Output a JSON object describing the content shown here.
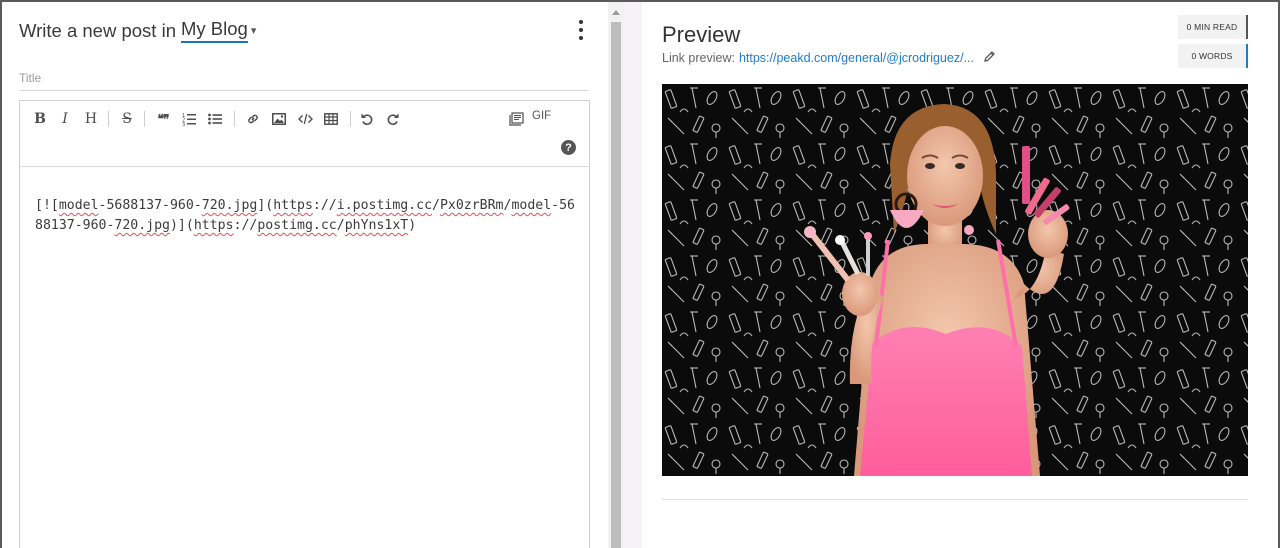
{
  "editor": {
    "header_prefix": "Write a new post in",
    "blog_name": "My Blog",
    "title_placeholder": "Title",
    "gif_label": "GIF",
    "help_label": "?",
    "toolbar": {
      "bold": "B",
      "italic": "I",
      "heading": "H",
      "strike": "S",
      "quote": "❝❞"
    },
    "markdown": {
      "p1": "[![",
      "p2": "model",
      "p3": "-5688137-960-",
      "p4": "720.jpg",
      "p5": "](",
      "p6": "https",
      "p7": "://",
      "p8": "i.postimg.cc",
      "p9": "/",
      "p10": "Px0zrBRm",
      "p11": "/",
      "p12": "model",
      "p13": "-5688137-960-",
      "p14": "720.jpg",
      "p15": ")](",
      "p16": "https",
      "p17": "://",
      "p18": "postimg.cc",
      "p19": "/",
      "p20": "phYns1xT",
      "p21": ")"
    }
  },
  "preview": {
    "title": "Preview",
    "link_label": "Link preview:",
    "link_url": "https://peakd.com/general/@jcrodriguez/...",
    "min_read": "0 MIN READ",
    "words": "0 WORDS",
    "image_alt": "model-5688137-960-720.jpg"
  },
  "colors": {
    "accent": "#1a75c9",
    "link": "#1f7ec2",
    "dress": "#ff6fa8",
    "background_pattern": "#0b0b0b"
  },
  "icons": {
    "menu": "kebab-icon",
    "edit": "pencil-icon",
    "help": "help-icon"
  }
}
